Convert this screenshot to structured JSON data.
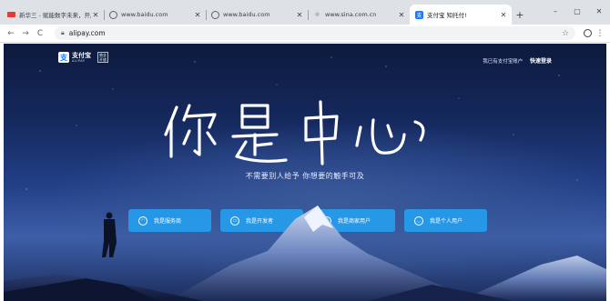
{
  "tabs": [
    {
      "title": "新华三 - 赋能数字未来，开启数字时代",
      "favicon": "news-icon",
      "active": false
    },
    {
      "title": "www.baidu.com",
      "favicon": "globe-icon",
      "active": false
    },
    {
      "title": "www.baidu.com",
      "favicon": "globe-icon",
      "active": false
    },
    {
      "title": "www.sina.com.cn",
      "favicon": "sina-icon",
      "active": false
    },
    {
      "title": "支付宝 知托付!",
      "favicon": "alipay-icon",
      "active": true
    }
  ],
  "window_controls": {
    "minimize": "–",
    "maximize": "▢",
    "close": "✕"
  },
  "new_tab_label": "+",
  "address_bar": {
    "url": "alipay.com"
  },
  "page": {
    "logo_text": "支付宝",
    "logo_sub": "ALIPAY",
    "logo_badge": "商业服务\n开放",
    "top_link_text": "我已有支付宝账户",
    "login_label": "快速登录",
    "slogan": "你是中心",
    "subtitle": "不需要别人给予 你想要的触手可及",
    "cta_buttons": [
      {
        "label": "我是服务商",
        "icon": "person-icon"
      },
      {
        "label": "我是开发者",
        "icon": "developer-icon"
      },
      {
        "label": "我是商家用户",
        "icon": "store-icon"
      },
      {
        "label": "我是个人用户",
        "icon": "user-icon"
      }
    ]
  },
  "colors": {
    "accent": "#1677ff",
    "cta": "#24a0f0",
    "tabstrip": "#dee1e6"
  }
}
